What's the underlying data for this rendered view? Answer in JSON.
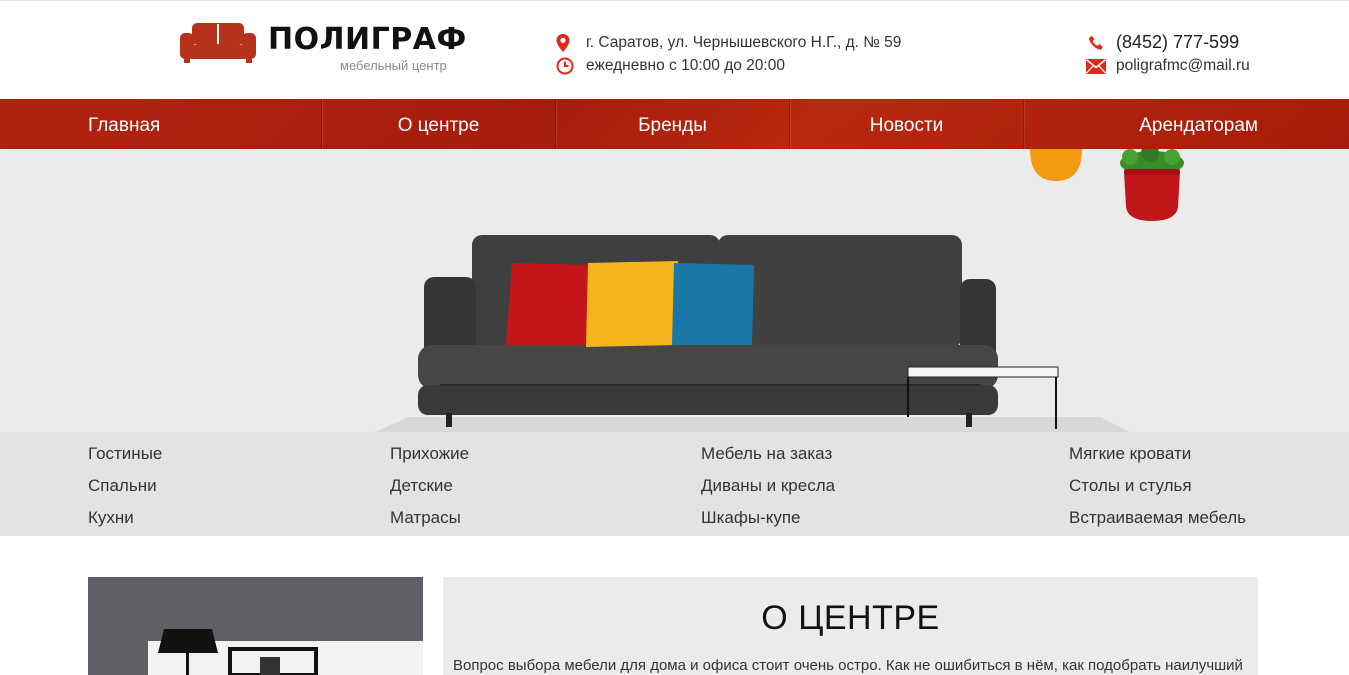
{
  "logo": {
    "title": "ПОЛИГРАФ",
    "subtitle": "мебельный центр",
    "icon": "sofa-logo-icon"
  },
  "contacts": {
    "address": "г. Саратов, ул. Чернышевского Н.Г., д. № 59",
    "hours": "ежедневно с 10:00 до 20:00",
    "phone": "(8452) 777-599",
    "email": "poligrafmc@mail.ru",
    "icons": [
      "map-pin-icon",
      "clock-icon",
      "phone-icon",
      "envelope-icon"
    ]
  },
  "nav": {
    "items": [
      {
        "label": "Главная"
      },
      {
        "label": "О центре"
      },
      {
        "label": "Бренды"
      },
      {
        "label": "Новости"
      },
      {
        "label": "Арендаторам"
      }
    ]
  },
  "categories": {
    "columns": [
      [
        "Гостиные",
        "Спальни",
        "Кухни"
      ],
      [
        "Прихожие",
        "Детские",
        "Матрасы"
      ],
      [
        "Мебель на заказ",
        "Диваны и кресла",
        "Шкафы-купе"
      ],
      [
        "Мягкие кровати",
        "Столы и стулья",
        "Встраиваемая мебель"
      ]
    ]
  },
  "about": {
    "title": "О ЦЕНТРЕ",
    "text": "Вопрос выбора мебели для дома и офиса стоит очень остро. Как не ошибиться в нём, как подобрать наилучший"
  },
  "colors": {
    "brand_red": "#b02410",
    "icon_red": "#e0291a",
    "hero_bg": "#ebebeb",
    "category_bg": "#e3e3e3"
  }
}
